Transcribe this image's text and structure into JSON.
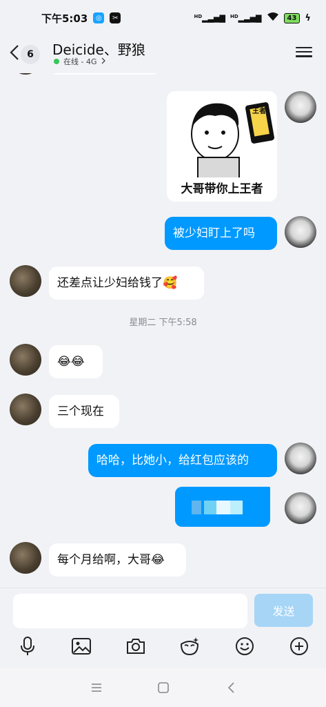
{
  "status_bar": {
    "time": "下午5:03",
    "network_1": "HD",
    "network_2": "HD",
    "battery": "43"
  },
  "header": {
    "unread_count": "6",
    "title": "Deicide、野狼",
    "presence": "在线 - 4G"
  },
  "messages": {
    "sticker_caption": "大哥带你上王者",
    "sticker_badge": "王者",
    "msg_out_1": "被少妇盯上了吗",
    "msg_in_1": "还差点让少妇给钱了🥰",
    "timestamp": "星期二 下午5:58",
    "msg_in_2": "😂😂",
    "msg_in_3": "三个现在",
    "msg_out_2": "哈哈，比她小，给红包应该的",
    "msg_in_4": "每个月给啊，大哥😂"
  },
  "composer": {
    "input_value": "",
    "send_label": "发送"
  },
  "toolbar_icons": [
    "microphone-icon",
    "image-icon",
    "camera-icon",
    "magic-emoji-icon",
    "emoji-icon",
    "plus-icon"
  ],
  "colors": {
    "accent": "#0099ff",
    "send_disabled": "#a6d5f6",
    "background": "#f1f2f6",
    "online": "#35c759"
  }
}
